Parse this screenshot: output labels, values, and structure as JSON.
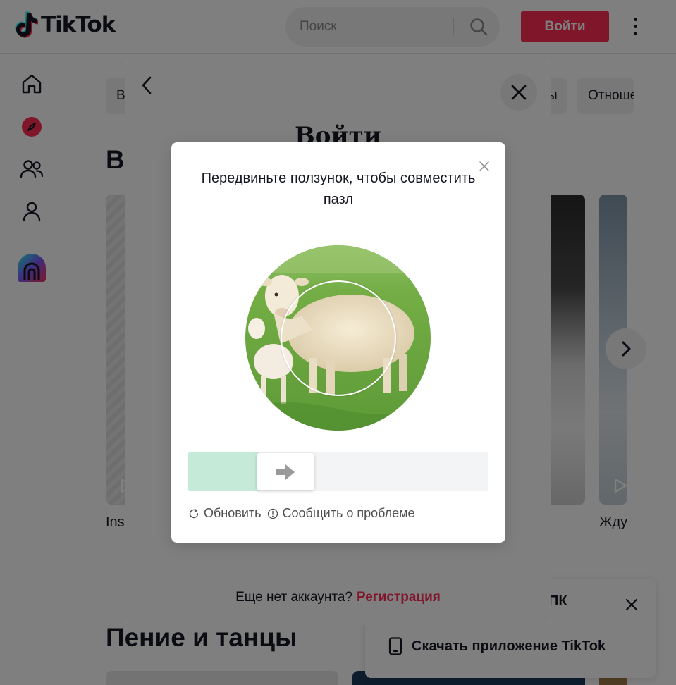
{
  "header": {
    "logo_text": "TikTok",
    "search_placeholder": "Поиск",
    "login_label": "Войти",
    "colors": {
      "accent": "#fe2c55",
      "text": "#161823",
      "search_bg": "#f1f1f2"
    }
  },
  "sidebar": {
    "items": [
      {
        "icon": "home-icon"
      },
      {
        "icon": "explore-icon"
      },
      {
        "icon": "following-icon"
      },
      {
        "icon": "profile-icon"
      },
      {
        "icon": "live-icon"
      }
    ]
  },
  "feed": {
    "chips": [
      "В",
      "ы",
      "Отноше"
    ],
    "section1_title_partial": "В",
    "captions": [
      "Ins",
      "Жду"
    ],
    "section2_title": "Пение и танцы"
  },
  "download_popup": {
    "title_partial": "ПК",
    "link_label": "Скачать приложение TikTok"
  },
  "login_modal": {
    "title": "Войти",
    "footer_text": "Еще нет аккаунта?",
    "signup_label": "Регистрация"
  },
  "captcha": {
    "title": "Передвиньте ползунок, чтобы совместить пазл",
    "slider_progress_fraction": 0.27,
    "refresh_label": "Обновить",
    "report_label": "Сообщить о проблеме",
    "colors": {
      "slider_fill": "#c5ebd8",
      "track": "#f3f4f6"
    }
  }
}
